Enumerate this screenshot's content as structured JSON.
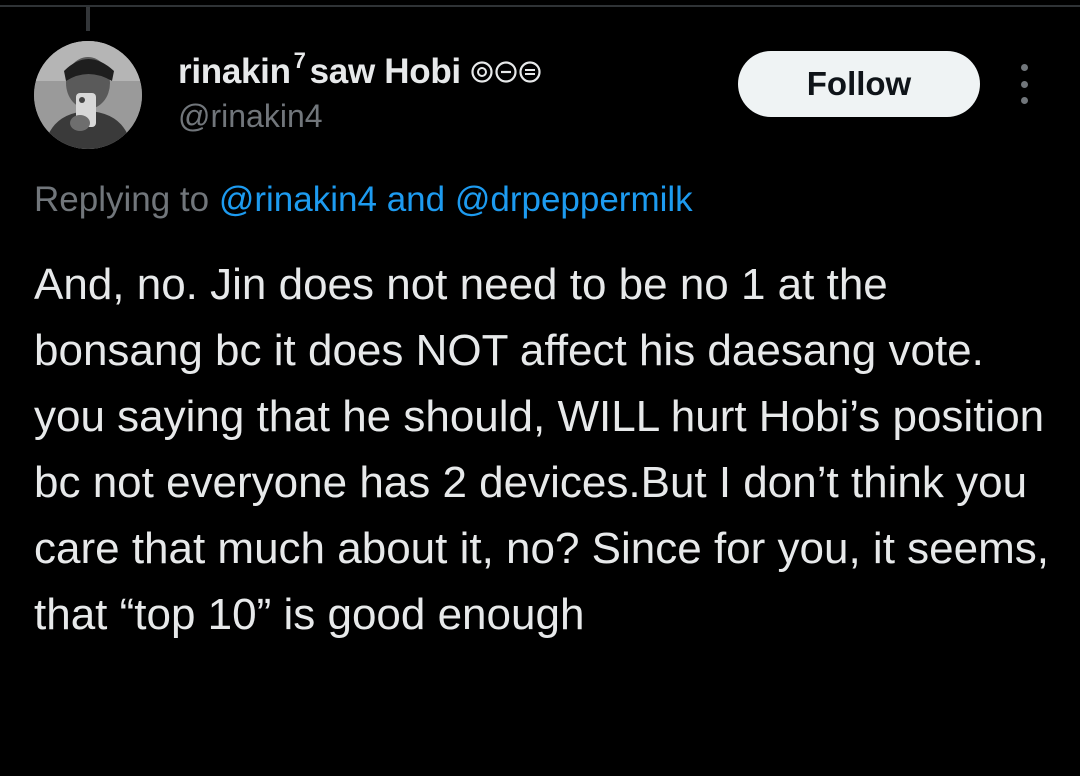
{
  "tweet": {
    "author": {
      "name": "rinakin",
      "name_superscript": "7",
      "name_suffix": "saw Hobi",
      "badge_icons": [
        "purple-circle-emoji",
        "purple-heart-emoji",
        "purple-face-emoji"
      ],
      "handle": "@rinakin4"
    },
    "follow_label": "Follow",
    "more_icon": "more-vertical-icon",
    "reply": {
      "prefix": "Replying to",
      "mention_1": "@rinakin4",
      "joiner": "and",
      "mention_2": "@drpeppermilk"
    },
    "text": "And, no. Jin does not need to be no 1 at the bonsang bc it does NOT affect his daesang vote. you saying that he should, WILL hurt Hobi’s position bc not everyone has 2 devices.But I don’t think you care that much about it, no? Since for you, it seems, that “top 10” is good enough"
  },
  "colors": {
    "background": "#000000",
    "text_primary": "#e7e9ea",
    "text_secondary": "#71767b",
    "link": "#1d9bf0",
    "follow_button_bg": "#eff3f4"
  }
}
